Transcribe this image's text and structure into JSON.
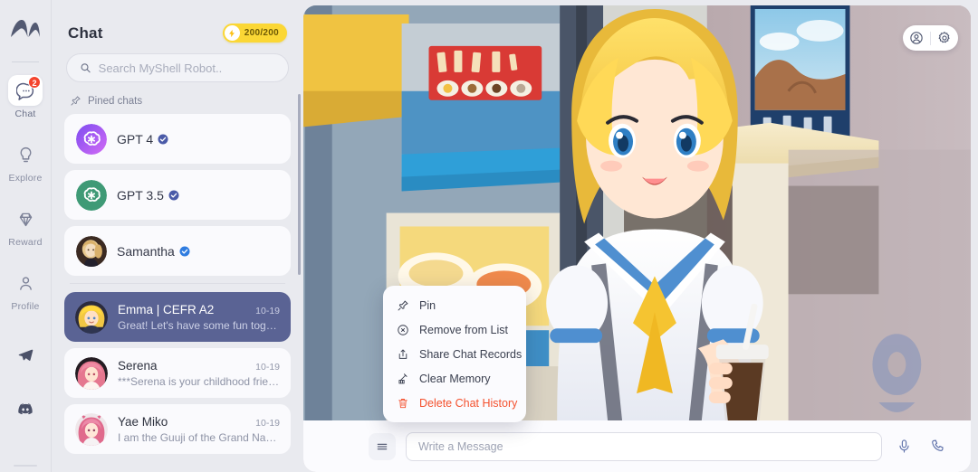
{
  "rail": {
    "logo_name": "myshell-logo",
    "items": [
      {
        "id": "chat",
        "label": "Chat",
        "icon": "chat-bubble-icon",
        "badge": "2",
        "active": true
      },
      {
        "id": "explore",
        "label": "Explore",
        "icon": "lightbulb-icon",
        "badge": "",
        "active": false
      },
      {
        "id": "reward",
        "label": "Reward",
        "icon": "diamond-icon",
        "badge": "",
        "active": false
      },
      {
        "id": "profile",
        "label": "Profile",
        "icon": "person-icon",
        "badge": "",
        "active": false
      }
    ],
    "social": [
      {
        "id": "telegram",
        "icon": "telegram-icon"
      },
      {
        "id": "discord",
        "icon": "discord-icon"
      }
    ]
  },
  "panel": {
    "title": "Chat",
    "energy": {
      "value": "200/200",
      "icon": "lightning-bolt-icon",
      "color": "#fbd735"
    },
    "search": {
      "value": "",
      "placeholder": "Search MyShell Robot.."
    },
    "pinned_label": "Pined chats",
    "pinned_icon": "pin-icon",
    "pinned": [
      {
        "name": "GPT 4",
        "avatar": "openai-purple-avatar",
        "verified": true
      },
      {
        "name": "GPT 3.5",
        "avatar": "openai-green-avatar",
        "verified": true
      },
      {
        "name": "Samantha",
        "avatar": "samantha-photo-avatar",
        "verified": true
      }
    ],
    "chats": [
      {
        "name": "Emma | CEFR A2",
        "time": "10-19",
        "preview": "Great! Let's have some fun togeth...",
        "avatar": "emma-avatar",
        "selected": true
      },
      {
        "name": "Serena",
        "time": "10-19",
        "preview": "***Serena is your childhood friend ...",
        "avatar": "serena-avatar",
        "selected": false
      },
      {
        "name": "Yae Miko",
        "time": "10-19",
        "preview": "I am the Guuji of the Grand Naruk...",
        "avatar": "yaemiko-avatar",
        "selected": false
      }
    ]
  },
  "stage": {
    "hero_alt": "anime-blonde-schoolgirl-at-food-stall",
    "topright": [
      {
        "id": "account",
        "icon": "account-circle-icon"
      },
      {
        "id": "settings",
        "icon": "gear-icon"
      }
    ],
    "context_menu": [
      {
        "label": "Pin",
        "icon": "pin-icon",
        "danger": false
      },
      {
        "label": "Remove from List",
        "icon": "circle-x-icon",
        "danger": false
      },
      {
        "label": "Share Chat Records",
        "icon": "share-icon",
        "danger": false
      },
      {
        "label": "Clear Memory",
        "icon": "broom-icon",
        "danger": false
      },
      {
        "label": "Delete Chat History",
        "icon": "trash-icon",
        "danger": true
      }
    ],
    "composer": {
      "menu_icon": "hamburger-icon",
      "input_value": "",
      "input_placeholder": "Write a Message",
      "mic_icon": "microphone-icon",
      "call_icon": "phone-icon"
    }
  },
  "colors": {
    "app_bg": "#e9eaef",
    "card_bg": "#fafafd",
    "selected_chat": "#5a6394",
    "accent_yellow": "#fbd735",
    "danger_red": "#f4512e",
    "badge_red": "#f4442e",
    "verified_blue": "#4a5aa8"
  }
}
